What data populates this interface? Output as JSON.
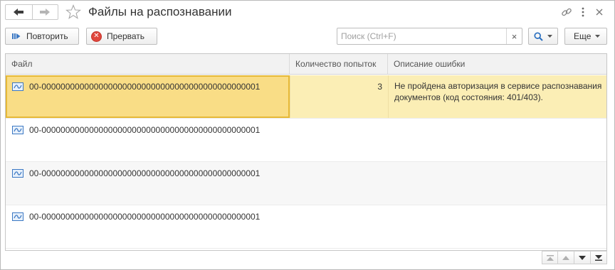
{
  "window": {
    "title": "Файлы на распознавании"
  },
  "toolbar": {
    "retry_label": "Повторить",
    "abort_label": "Прервать",
    "search_placeholder": "Поиск (Ctrl+F)",
    "more_label": "Еще"
  },
  "table": {
    "columns": [
      "Файл",
      "Количество попыток",
      "Описание ошибки"
    ],
    "rows": [
      {
        "file": "00-0000000000000000000000000000000000000000000001",
        "attempts": "3",
        "error": "Не пройдена авторизация в сервисе распознавания документов (код состояния: 401/403)."
      },
      {
        "file": "00-0000000000000000000000000000000000000000000001",
        "attempts": "",
        "error": ""
      },
      {
        "file": "00-0000000000000000000000000000000000000000000001",
        "attempts": "",
        "error": ""
      },
      {
        "file": "00-0000000000000000000000000000000000000000000001",
        "attempts": "",
        "error": ""
      }
    ]
  },
  "colors": {
    "selected_row": "#fbeeb5",
    "selected_cell": "#f9dd86",
    "selected_border": "#e6b937",
    "abort_icon": "#e0463c",
    "accent_blue": "#3b78c4"
  },
  "icons": {
    "back": "arrow-left-icon",
    "forward": "arrow-right-icon",
    "favorite": "star-icon",
    "link": "link-icon",
    "menu": "more-vertical-icon",
    "close": "close-icon",
    "retry": "retry-icon",
    "abort": "abort-icon",
    "search": "search-icon",
    "file": "scanned-document-icon"
  }
}
